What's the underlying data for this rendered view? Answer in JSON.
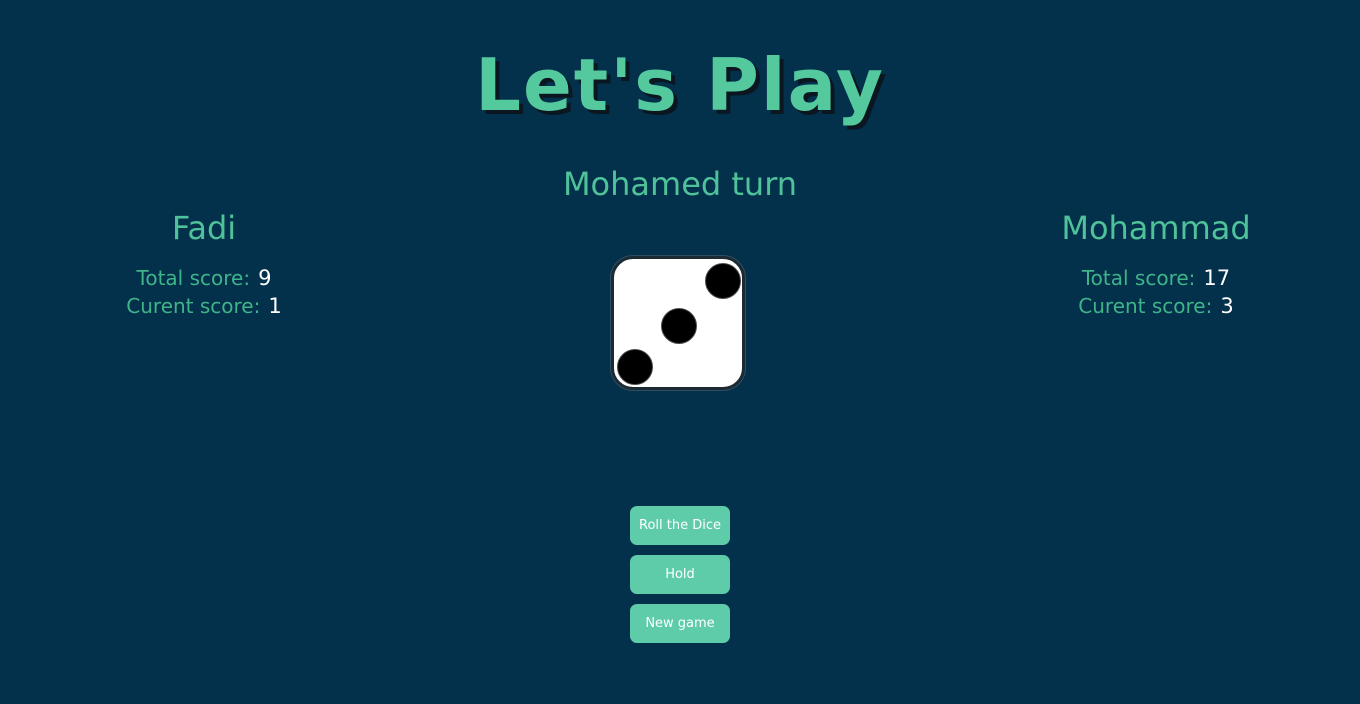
{
  "title": "Let's Play",
  "turn_text": "Mohamed turn",
  "players": [
    {
      "name": "Fadi",
      "total_label": "Total score:",
      "total_value": "9",
      "current_label": "Curent score:",
      "current_value": "1"
    },
    {
      "name": "Mohammad",
      "total_label": "Total score:",
      "total_value": "17",
      "current_label": "Curent score:",
      "current_value": "3"
    }
  ],
  "dice": {
    "value": 3,
    "icon": "dice-three-icon"
  },
  "buttons": {
    "roll": "Roll the Dice",
    "hold": "Hold",
    "new_game": "New game"
  },
  "colors": {
    "background": "#03304b",
    "accent": "#4fc29a",
    "button": "#5fcca9",
    "score_value": "#ffffff"
  }
}
